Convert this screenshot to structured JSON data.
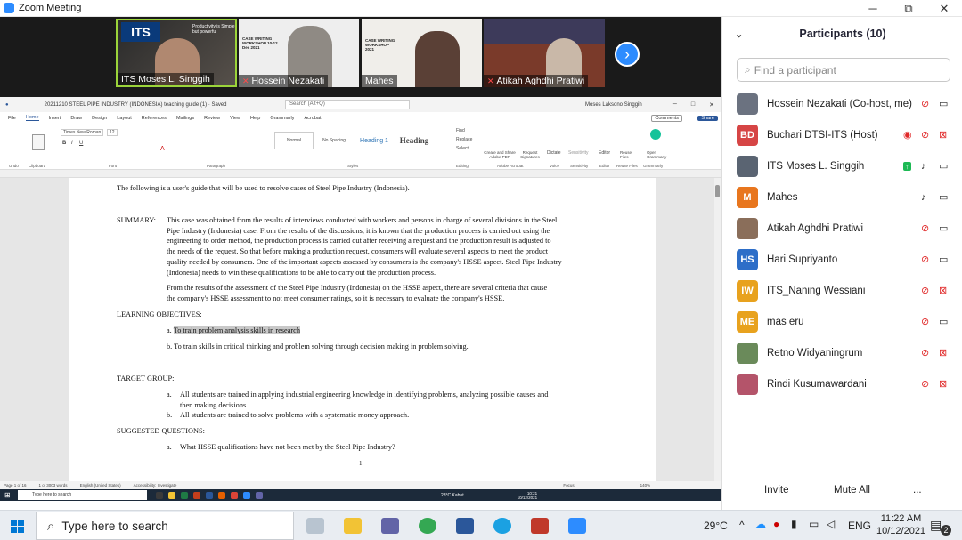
{
  "window": {
    "title": "Zoom Meeting",
    "minimize": "─",
    "maximize": "⧉",
    "close": "✕"
  },
  "videos": [
    {
      "name": "ITS Moses L. Singgih",
      "muted": false,
      "logo": "ITS",
      "slogan": "Productivity is Simple but powerful"
    },
    {
      "name": "Hossein Nezakati",
      "muted": true,
      "banner": "CASE WRITING WORKSHOP 10-12 Dec 2021"
    },
    {
      "name": "Mahes",
      "muted": false,
      "banner": "CASE WRITING WORKSHOP 2021"
    },
    {
      "name": "Atikah Aghdhi Pratiwi",
      "muted": true
    }
  ],
  "next_arrow": "›",
  "word": {
    "title": "20211210 STEEL PIPE INDUSTRY (INDONESIA) teaching guide (1) · Saved",
    "search": "Search (Alt+Q)",
    "user": "Moses Laksono Singgih",
    "menu": [
      "File",
      "Home",
      "Insert",
      "Draw",
      "Design",
      "Layout",
      "References",
      "Mailings",
      "Review",
      "View",
      "Help",
      "Grammarly",
      "Acrobat"
    ],
    "comments": "Comments",
    "share": "Share",
    "font": "Times New Roman",
    "font_size": "12",
    "styles": [
      "Normal",
      "No Spacing",
      "Heading 1",
      "Heading"
    ],
    "groups": [
      "Undo",
      "Clipboard",
      "Font",
      "Paragraph",
      "Styles",
      "Editing",
      "Adobe Acrobat",
      "Voice",
      "Sensitivity",
      "Editor",
      "Reuse Files",
      "Grammarly"
    ],
    "ribbon_tools": [
      "Find",
      "Replace",
      "Select",
      "Create and Share Adobe PDF",
      "Request Signatures",
      "Dictate",
      "Sensitivity",
      "Editor",
      "Reuse Files",
      "Open Grammarly"
    ],
    "status": [
      "Page 1 of 16",
      "1 of 3003 words",
      "English (United States)",
      "Accessibility: Investigate",
      "Focus",
      "140%"
    ],
    "page_number": "1"
  },
  "doc": {
    "intro": "The following is a user's guide that will be used to resolve cases of Steel Pipe Industry (Indonesia).",
    "summary_label": "SUMMARY:",
    "summary_lines": [
      "This case was obtained from the results of interviews conducted with workers and persons in charge of several divisions in the Steel",
      "Pipe Industry (Indonesia) case. From the results of the discussions, it is known that the production process is carried out using the",
      "engineering to order method, the production process is carried out after receiving a request and the production result is adjusted to",
      "the needs of the request. So that before making a production request, consumers will evaluate several aspects to meet the product",
      "quality needed by consumers. One of the important aspects assessed by consumers is the company's HSSE aspect. Steel Pipe Industry",
      "(Indonesia) needs to win these qualifications to be able to carry out the production process."
    ],
    "summary2_lines": [
      "From the results of the assessment of the Steel Pipe Industry (Indonesia) on the HSSE aspect, there are several criteria that cause",
      "the company's HSSE assessment to not meet consumer ratings, so it is necessary to evaluate the company's HSSE."
    ],
    "objectives_label": "LEARNING OBJECTIVES:",
    "objectives": [
      {
        "marker": "a.",
        "text": "To train problem analysis skills in research"
      },
      {
        "marker": "b.",
        "text": "To train skills in critical thinking and problem solving through decision making in problem solving."
      }
    ],
    "target_label": "TARGET GROUP:",
    "target_a_marker": "a.",
    "target_a_lines": [
      "All students are trained in applying industrial engineering knowledge in identifying problems, analyzing possible causes and",
      "then making decisions."
    ],
    "target_b_marker": "b.",
    "target_b": "All students are trained to solve problems with a systematic money approach.",
    "questions_label": "SUGGESTED QUESTIONS:",
    "question_a_marker": "a.",
    "question_a": "What HSSE qualifications have not been met by the Steel Pipe Industry?"
  },
  "inner_taskbar": {
    "search": "Type here to search",
    "weather": "28°C Kabut",
    "time": "10:21",
    "date": "10/12/2021"
  },
  "participants_panel": {
    "title": "Participants (10)",
    "find_placeholder": "Find a participant",
    "participants": [
      {
        "name": "Hossein Nezakati (Co-host, me)",
        "initials": "",
        "color": "#6b7280",
        "mic": "muted",
        "video": "on",
        "record": false,
        "share": false
      },
      {
        "name": "Buchari DTSI-ITS (Host)",
        "initials": "BD",
        "color": "#d64545",
        "mic": "muted",
        "video": "off",
        "record": true,
        "share": false
      },
      {
        "name": "ITS Moses L. Singgih",
        "initials": "",
        "color": "#5a6472",
        "mic": "on",
        "video": "on",
        "record": false,
        "share": true
      },
      {
        "name": "Mahes",
        "initials": "M",
        "color": "#e8761e",
        "mic": "on",
        "video": "on",
        "record": false,
        "share": false
      },
      {
        "name": "Atikah Aghdhi Pratiwi",
        "initials": "",
        "color": "#8a6e5a",
        "mic": "muted",
        "video": "on",
        "record": false,
        "share": false
      },
      {
        "name": "Hari Supriyanto",
        "initials": "HS",
        "color": "#2d6ec8",
        "mic": "muted",
        "video": "on",
        "record": false,
        "share": false
      },
      {
        "name": "ITS_Naning Wessiani",
        "initials": "IW",
        "color": "#e8a21e",
        "mic": "muted",
        "video": "off",
        "record": false,
        "share": false
      },
      {
        "name": "mas eru",
        "initials": "ME",
        "color": "#e8a21e",
        "mic": "muted",
        "video": "on",
        "record": false,
        "share": false
      },
      {
        "name": "Retno Widyaningrum",
        "initials": "",
        "color": "#6a8a5a",
        "mic": "muted",
        "video": "off",
        "record": false,
        "share": false
      },
      {
        "name": "Rindi Kusumawardani",
        "initials": "",
        "color": "#b4546a",
        "mic": "muted",
        "video": "off",
        "record": false,
        "share": false
      }
    ],
    "invite": "Invite",
    "mute_all": "Mute All",
    "more": "..."
  },
  "taskbar": {
    "search_placeholder": "Type here to search",
    "temperature": "29°C",
    "language": "ENG",
    "time": "11:22 AM",
    "date": "10/12/2021",
    "notifications": "2"
  },
  "colors": {
    "zoom_blue": "#2d8cff",
    "word_blue": "#2b579a",
    "muted_red": "#e02828",
    "meeting_bg": "#1a1a1a"
  }
}
